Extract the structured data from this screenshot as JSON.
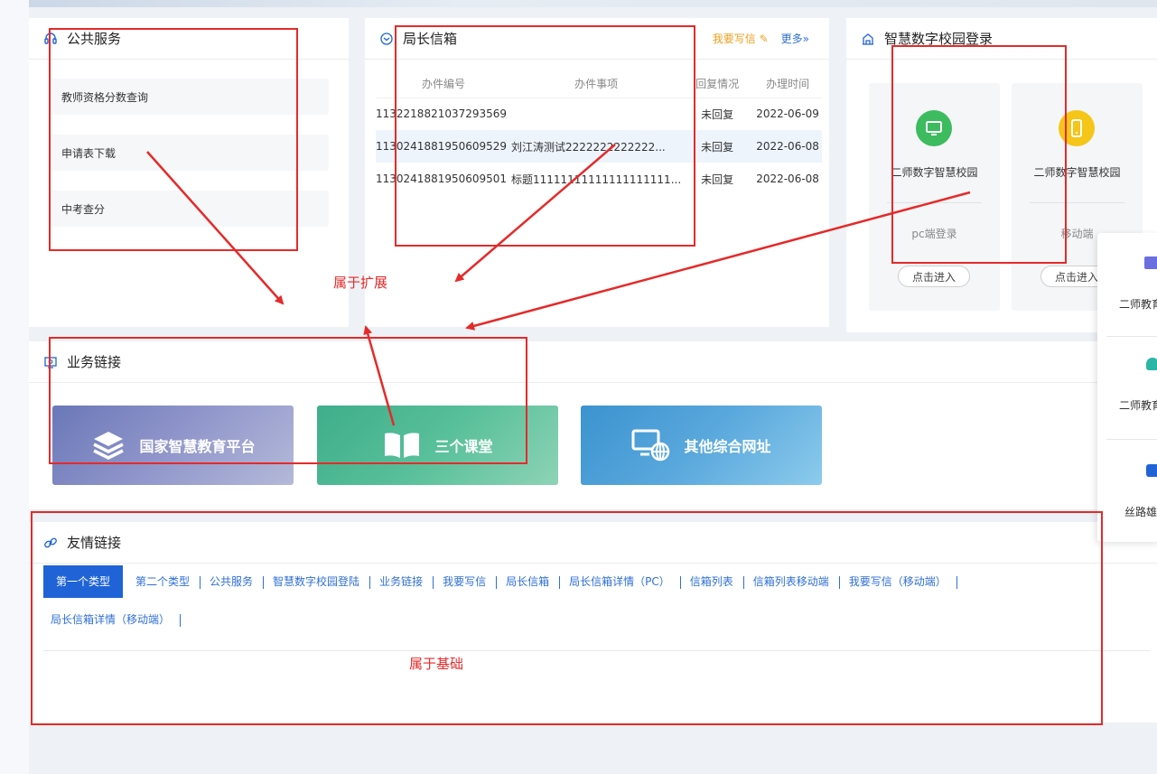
{
  "public_service": {
    "title": "公共服务",
    "items": [
      "教师资格分数查询",
      "申请表下载",
      "中考查分"
    ]
  },
  "mailbox": {
    "title": "局长信箱",
    "write_label": "我要写信",
    "more_label": "更多»",
    "columns": [
      "办件编号",
      "办件事项",
      "回复情况",
      "办理时间"
    ],
    "rows": [
      {
        "id": "1132218821037293569",
        "subject": "",
        "status": "未回复",
        "date": "2022-06-09"
      },
      {
        "id": "1130241881950609529",
        "subject": "刘江涛测试2222222222222...",
        "status": "未回复",
        "date": "2022-06-08"
      },
      {
        "id": "1130241881950609501",
        "subject": "标题11111111111111111111...",
        "status": "未回复",
        "date": "2022-06-08"
      }
    ]
  },
  "campus": {
    "title": "智慧数字校园登录",
    "cards": [
      {
        "name": "二师数字智慧校园",
        "type": "pc端登录",
        "button": "点击进入",
        "color": "#3dbb5f",
        "icon": "monitor-icon"
      },
      {
        "name": "二师数字智慧校园",
        "type": "移动端",
        "button": "点击进入",
        "color": "#f5c518",
        "icon": "phone-icon"
      }
    ]
  },
  "business": {
    "title": "业务链接",
    "banners": [
      {
        "label": "国家智慧教育平台",
        "icon": "layers-icon"
      },
      {
        "label": "三个课堂",
        "icon": "book-icon"
      },
      {
        "label": "其他综合网址",
        "icon": "web-icon"
      }
    ]
  },
  "friendly": {
    "title": "友情链接",
    "tabs": [
      "第一个类型",
      "第二个类型",
      "公共服务",
      "智慧数字校园登陆",
      "业务链接",
      "我要写信",
      "局长信箱",
      "局长信箱详情（PC）",
      "信箱列表",
      "信箱列表移动端",
      "我要写信（移动端）",
      "局长信箱详情（移动端）"
    ]
  },
  "side_panel": {
    "items": [
      "二师教育",
      "二师教育",
      "丝路雄"
    ]
  },
  "annotations": {
    "extension": "属于扩展",
    "base": "属于基础"
  }
}
